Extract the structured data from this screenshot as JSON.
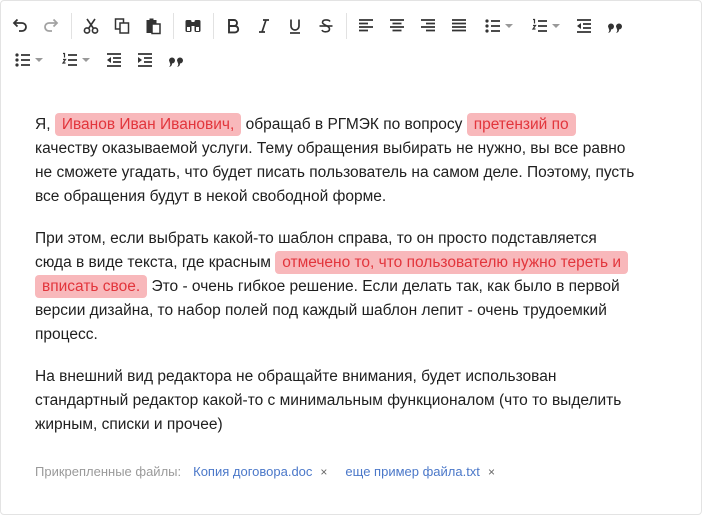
{
  "toolbar": {
    "icons": [
      "undo-icon",
      "redo-icon",
      "cut-icon",
      "copy-icon",
      "paste-icon",
      "find-icon",
      "bold-icon",
      "italic-icon",
      "underline-icon",
      "strikethrough-icon",
      "align-left-icon",
      "align-center-icon",
      "align-right-icon",
      "align-justify-icon",
      "bullet-list-icon",
      "numbered-list-icon",
      "outdent-icon",
      "blockquote-icon",
      "indent-icon"
    ]
  },
  "content": {
    "p1": {
      "t1": "Я, ",
      "h1": "Иванов Иван Иванович,",
      "t2": "  обращаб в РГМЭК по вопросу ",
      "h2": "претензий по",
      "t3": " качеству  оказываемой услуги. Тему обращения выбирать не нужно, вы все равно не сможете угадать,  что будет писать  пользователь на самом деле. Поэтому,  пусть все обращения будут в некой свободной форме."
    },
    "p2": {
      "t1": "При этом, если выбрать  какой-то  шаблон  справа, то он просто подставляется  сюда в виде текста, где красным ",
      "h1": "отмечено то, что пользователю нужно тереть и  вписать свое.",
      "t2": "  Это - очень гибкое решение. Если делать так,  как было в первой версии дизайна,  то набор полей под каждый шаблон лепит - очень трудоемкий  процесс."
    },
    "p3": "На  внешний вид  редактора не  обращайте внимания, будет использован стандартный редактор какой-то с  минимальным функционалом  (что то выделить жирным,  списки и  прочее)"
  },
  "attachments": {
    "label": "Прикрепленные файлы:",
    "files": [
      {
        "name": "Копия договора.doc",
        "remove": "×"
      },
      {
        "name": "еще пример файла.txt",
        "remove": "×"
      }
    ]
  },
  "colors": {
    "highlight_bg": "#f8b8bb",
    "highlight_text": "#e2353c",
    "link": "#4b78c9"
  }
}
